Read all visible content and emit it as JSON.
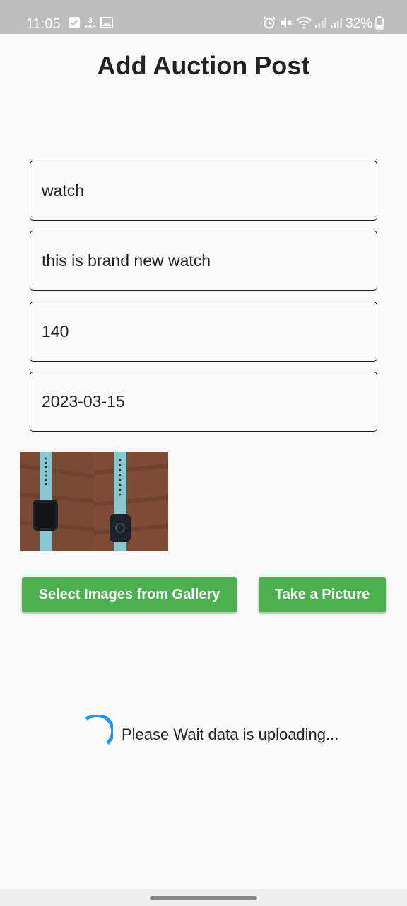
{
  "status_bar": {
    "time": "11:05",
    "netspeed_value": "3",
    "netspeed_unit": "KB/s",
    "battery": "32%",
    "icons": [
      "check-icon",
      "gallery-icon",
      "alarm-icon",
      "mute-icon",
      "wifi-icon",
      "signal-icon",
      "signal-icon",
      "battery-icon"
    ]
  },
  "page": {
    "title": "Add Auction Post"
  },
  "form": {
    "title_value": "watch",
    "description_value": "this is brand new watch",
    "price_value": "140",
    "end_date_value": "2023-03-15"
  },
  "images": {
    "count": 2
  },
  "buttons": {
    "gallery_label": "Select Images from Gallery",
    "camera_label": "Take a Picture",
    "color": "#4caf50"
  },
  "loading": {
    "message": "Please Wait data is uploading...",
    "spinner_color": "#2196f3"
  }
}
